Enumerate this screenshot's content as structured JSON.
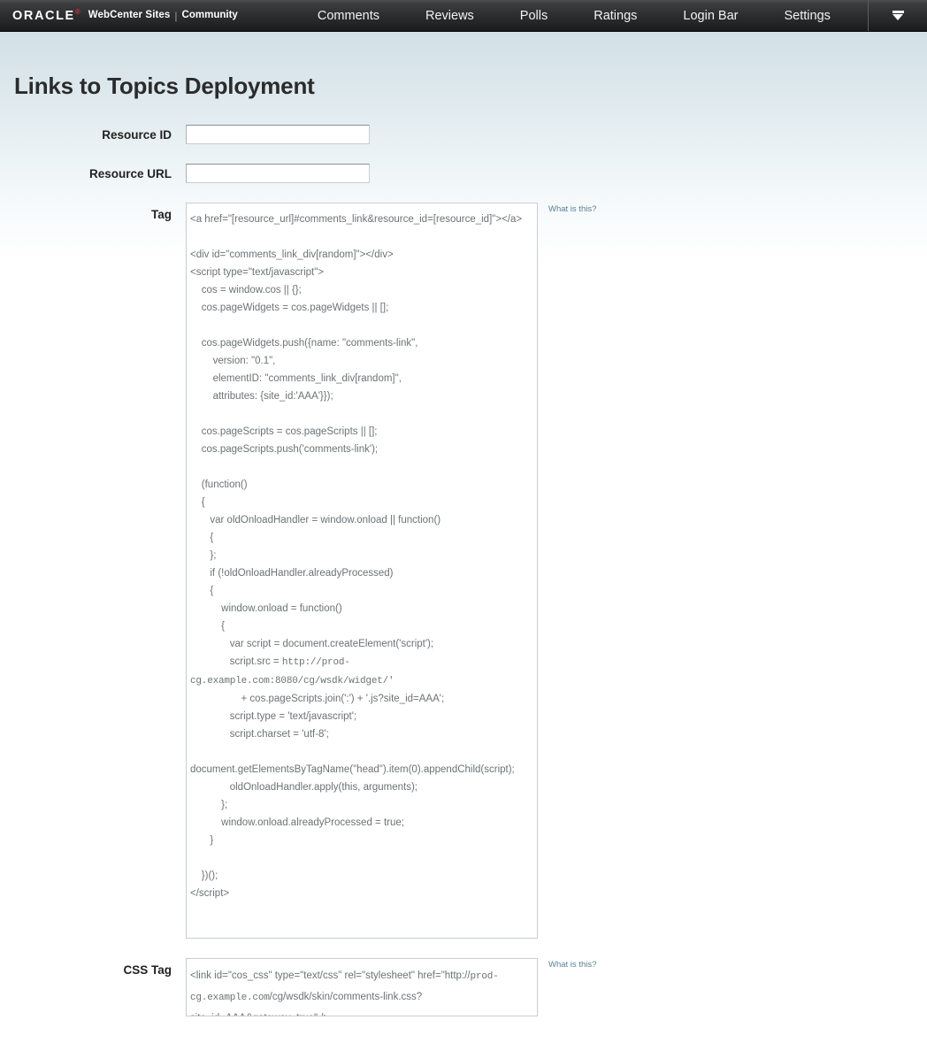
{
  "topbar": {
    "logo_text": "ORACLE",
    "logo_reg": "®",
    "product": "WebCenter Sites",
    "separator": "|",
    "suite": "Community",
    "nav": [
      {
        "label": "Comments"
      },
      {
        "label": "Reviews"
      },
      {
        "label": "Polls"
      },
      {
        "label": "Ratings"
      },
      {
        "label": "Login Bar"
      },
      {
        "label": "Settings"
      }
    ],
    "menu_icon": "chevron-down-icon"
  },
  "page": {
    "title": "Links to Topics Deployment"
  },
  "form": {
    "resource_id": {
      "label": "Resource ID",
      "value": "",
      "placeholder": ""
    },
    "resource_url": {
      "label": "Resource URL",
      "value": "",
      "placeholder": ""
    },
    "tag": {
      "label": "Tag",
      "help_label": "What is this?",
      "value_part1": "<a href=\"[resource_url]#comments_link&resource_id=[resource_id]\"></a>\n\n<div id=\"comments_link_div[random]\"></div>\n<script type=\"text/javascript\">\n    cos = window.cos || {};\n    cos.pageWidgets = cos.pageWidgets || [];\n\n    cos.pageWidgets.push({name: \"comments-link\",\n        version: \"0.1\",\n        elementID: \"comments_link_div[random]\",\n        attributes: {site_id:'AAA'}});\n\n    cos.pageScripts = cos.pageScripts || [];\n    cos.pageScripts.push('comments-link');\n\n    (function()\n    {\n       var oldOnloadHandler = window.onload || function()\n       {\n       };\n       if (!oldOnloadHandler.alreadyProcessed)\n       {\n           window.onload = function()\n           {\n              var script = document.createElement('script');\n              script.src = ",
      "value_url": "http://prod-cg.example.com:8080/cg/wsdk/widget/'",
      "value_part2": "\n                  + cos.pageScripts.join(':') + '.js?site_id=AAA';\n              script.type = 'text/javascript';\n              script.charset = 'utf-8';\n\ndocument.getElementsByTagName(\"head\").item(0).appendChild(script);\n              oldOnloadHandler.apply(this, arguments);\n           };\n           window.onload.alreadyProcessed = true;\n       }\n\n    })();\n</script>"
    },
    "css_tag": {
      "label": "CSS Tag",
      "help_label": "What is this?",
      "value_part1": "<link id=\"cos_css\" type=\"text/css\" rel=\"stylesheet\" href=\"http://",
      "value_url": "prod-cg.example.com",
      "value_part2": "/cg/wsdk/skin/comments-link.css?site_id=AAA&gateway=true\" />"
    }
  },
  "colors": {
    "topbar_dark": "#2d2f31",
    "page_gradient_top": "#d2e0e7",
    "title_color": "#2b2b2b",
    "code_text": "#6d7275",
    "help_link": "#5b7f96",
    "border": "#c9cdd0"
  }
}
